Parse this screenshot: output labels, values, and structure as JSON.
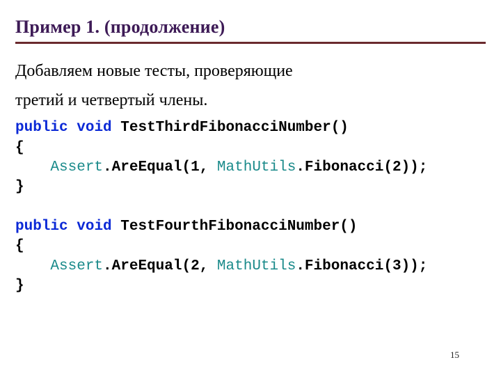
{
  "title": "Пример 1. (продолжение)",
  "body": {
    "line1": "Добавляем новые тесты, проверяющие",
    "line2": "третий и четвертый члены."
  },
  "code": {
    "kw_public": "public",
    "kw_void": "void",
    "m1_name": " TestThirdFibonacciNumber()",
    "open": "{",
    "indent": "    ",
    "cls_assert": "Assert",
    "dot_are": ".AreEqual(",
    "m1_arg1": "1",
    "comma": ", ",
    "cls_math": "MathUtils",
    "dot_fib": ".Fibonacci(",
    "m1_arg2": "2",
    "endcall": "));",
    "close": "}",
    "m2_name": " TestFourthFibonacciNumber()",
    "m2_arg1": "2",
    "m2_arg2": "3"
  },
  "page_number": "15"
}
